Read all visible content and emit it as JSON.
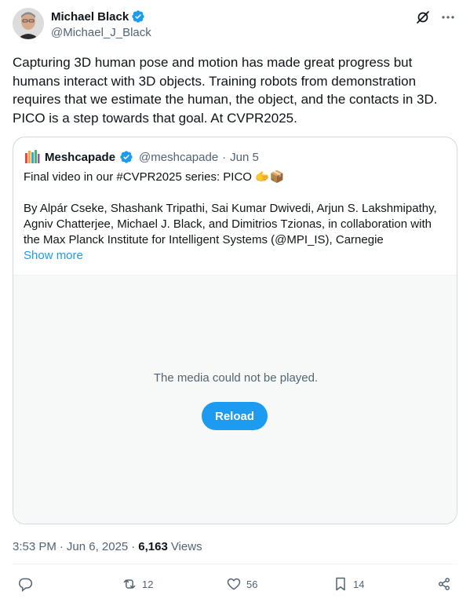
{
  "author": {
    "name": "Michael Black",
    "handle": "@Michael_J_Black"
  },
  "tweet": {
    "text": "Capturing 3D human pose and motion has made great progress but\nhumans interact with 3D objects. Training robots from demonstration\nrequires that we estimate the human, the object, and the contacts in 3D.\nPICO is a step towards that goal. At CVPR2025."
  },
  "quote": {
    "name": "Meshcapade",
    "handle": "@meshcapade",
    "separator": "·",
    "date": "Jun 5",
    "text": "Final video in our #CVPR2025 series: PICO 🫱📦\n\nBy Alpár Cseke, Shashank Tripathi, Sai Kumar Dwivedi, Arjun S. Lakshmipathy,\nAgniv Chatterjee, Michael J. Black, and Dimitrios Tzionas, in collaboration with\nthe Max Planck Institute for Intelligent Systems (@MPI_IS), Carnegie",
    "show_more": "Show more",
    "media_message": "The media could not be played.",
    "reload_label": "Reload"
  },
  "meta": {
    "time": "3:53 PM",
    "date": "Jun 6, 2025",
    "dot": "·",
    "views_count": "6,163",
    "views_label": "Views"
  },
  "actions": {
    "replies": "",
    "retweets": "12",
    "likes": "56",
    "bookmarks": "14"
  },
  "colors": {
    "accent": "#1d9bf0",
    "secondary_text": "#536471",
    "border": "#cfd9de"
  }
}
